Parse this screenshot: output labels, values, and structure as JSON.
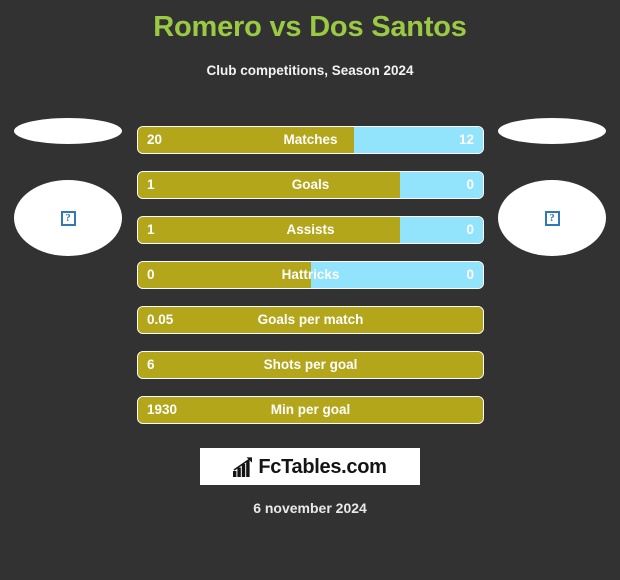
{
  "header": {
    "title": "Romero vs Dos Santos",
    "subtitle": "Club competitions, Season 2024"
  },
  "players": {
    "left": {
      "photo_alt": "broken-image",
      "glyph": "?"
    },
    "right": {
      "photo_alt": "broken-image",
      "glyph": "?"
    }
  },
  "colors": {
    "background": "#333233",
    "title": "#9ac943",
    "left_bar": "#b3a61b",
    "right_bar": "#92e3fc",
    "text": "#ffffff"
  },
  "chart_data": {
    "type": "bar",
    "title": "Romero vs Dos Santos",
    "subtitle": "Club competitions, Season 2024",
    "series": [
      {
        "name": "Romero",
        "side": "left",
        "color": "#b3a61b",
        "values": [
          "20",
          "1",
          "1",
          "0",
          "0.05",
          "6",
          "1930"
        ]
      },
      {
        "name": "Dos Santos",
        "side": "right",
        "color": "#92e3fc",
        "values": [
          "12",
          "0",
          "0",
          "0",
          "",
          "",
          ""
        ]
      }
    ],
    "categories": [
      "Matches",
      "Goals",
      "Assists",
      "Hattricks",
      "Goals per match",
      "Shots per goal",
      "Min per goal"
    ],
    "rows": [
      {
        "label": "Matches",
        "left": "20",
        "right": "12",
        "left_pct": 62.5,
        "split": true
      },
      {
        "label": "Goals",
        "left": "1",
        "right": "0",
        "left_pct": 76.0,
        "split": true
      },
      {
        "label": "Assists",
        "left": "1",
        "right": "0",
        "left_pct": 76.0,
        "split": true
      },
      {
        "label": "Hattricks",
        "left": "0",
        "right": "0",
        "left_pct": 50.0,
        "split": true
      },
      {
        "label": "Goals per match",
        "left": "0.05",
        "right": "",
        "left_pct": 100,
        "split": false
      },
      {
        "label": "Shots per goal",
        "left": "6",
        "right": "",
        "left_pct": 100,
        "split": false
      },
      {
        "label": "Min per goal",
        "left": "1930",
        "right": "",
        "left_pct": 100,
        "split": false
      }
    ]
  },
  "footer": {
    "logo_text": "FcTables.com",
    "logo_icon": "bar-chart-arrow-icon",
    "date": "6 november 2024"
  }
}
